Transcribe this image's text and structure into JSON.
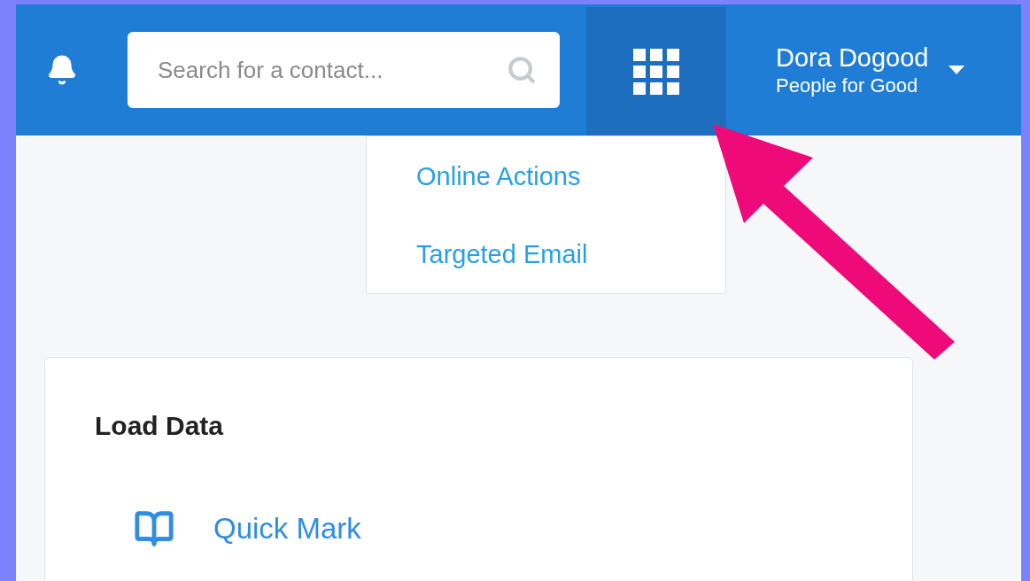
{
  "header": {
    "search": {
      "placeholder": "Search for a contact..."
    },
    "apps_menu": {
      "open": true,
      "items": [
        {
          "label": "Online Actions"
        },
        {
          "label": "Targeted Email"
        }
      ]
    },
    "user": {
      "name": "Dora Dogood",
      "organization": "People for Good"
    }
  },
  "card": {
    "title": "Load Data",
    "items": [
      {
        "label": "Quick Mark"
      }
    ]
  }
}
